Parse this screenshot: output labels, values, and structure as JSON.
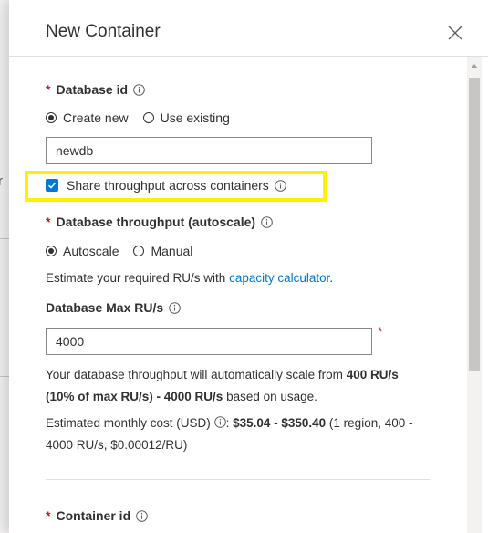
{
  "backdrop": {
    "partial_char": "r"
  },
  "panel": {
    "title": "New Container",
    "close_icon": "close-icon"
  },
  "database_id": {
    "label": "Database id",
    "required_mark": "*",
    "options": [
      "Create new",
      "Use existing"
    ],
    "selected": "Create new",
    "value": "newdb"
  },
  "share_throughput": {
    "label": "Share throughput across containers",
    "checked": true
  },
  "database_throughput": {
    "label": "Database throughput (autoscale)",
    "required_mark": "*",
    "options": [
      "Autoscale",
      "Manual"
    ],
    "selected": "Autoscale",
    "estimate_prefix": "Estimate your required RU/s with ",
    "estimate_link": "capacity calculator",
    "estimate_suffix": "."
  },
  "max_rus": {
    "label": "Database Max RU/s",
    "value": "4000",
    "required_mark": "*"
  },
  "autoscale_note": {
    "part1": "Your database throughput will automatically scale from ",
    "bold": "400 RU/s (10% of max RU/s) - 4000 RU/s",
    "part2": " based on usage."
  },
  "cost": {
    "label": "Estimated monthly cost (USD) ",
    "sep": ": ",
    "bold": "$35.04 - $350.40",
    "detail": " (1 region, 400 - 4000 RU/s, $0.00012/RU)"
  },
  "container_id": {
    "label": "Container id",
    "required_mark": "*"
  },
  "colors": {
    "accent": "#0078d4",
    "required": "#a4262c",
    "highlight": "#fff200"
  }
}
